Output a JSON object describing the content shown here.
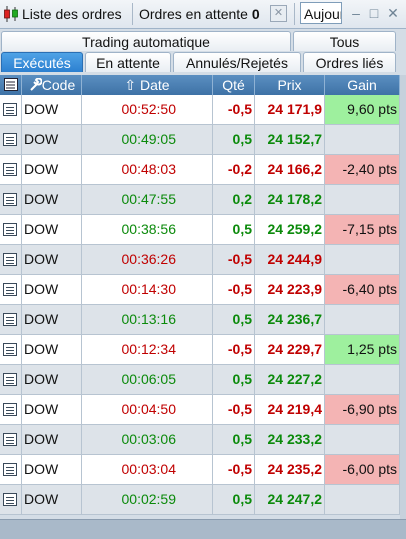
{
  "topbar": {
    "title": "Liste des ordres",
    "pending_label": "Ordres en attente",
    "pending_count": "0",
    "input_value": "Aujourd'hui",
    "close_label": "✕",
    "minimize": "–",
    "maximize": "□",
    "close_window": "✕"
  },
  "tabs_row1": [
    "Trading automatique",
    "Tous"
  ],
  "tabs_row2": [
    "Exécutés",
    "En attente",
    "Annulés/Rejetés",
    "Ordres liés"
  ],
  "columns": {
    "code": "Code",
    "date": "Date",
    "qty": "Qté",
    "prix": "Prix",
    "gain": "Gain"
  },
  "colors": {
    "up": "#0b8a0b",
    "down": "#c00000",
    "gain_pos": "#9ef09e",
    "gain_neg": "#f4b4b4"
  },
  "rows": [
    {
      "code": "DOW",
      "date": "00:52:50",
      "qty": "-0,5",
      "prix": "24 171,9",
      "gain": "9,60 pts",
      "dir": "down",
      "gain_sign": "pos"
    },
    {
      "code": "DOW",
      "date": "00:49:05",
      "qty": "0,5",
      "prix": "24 152,7",
      "gain": "",
      "dir": "up",
      "gain_sign": ""
    },
    {
      "code": "DOW",
      "date": "00:48:03",
      "qty": "-0,2",
      "prix": "24 166,2",
      "gain": "-2,40 pts",
      "dir": "down",
      "gain_sign": "neg"
    },
    {
      "code": "DOW",
      "date": "00:47:55",
      "qty": "0,2",
      "prix": "24 178,2",
      "gain": "",
      "dir": "up",
      "gain_sign": ""
    },
    {
      "code": "DOW",
      "date": "00:38:56",
      "qty": "0,5",
      "prix": "24 259,2",
      "gain": "-7,15 pts",
      "dir": "up",
      "gain_sign": "neg"
    },
    {
      "code": "DOW",
      "date": "00:36:26",
      "qty": "-0,5",
      "prix": "24 244,9",
      "gain": "",
      "dir": "down",
      "gain_sign": ""
    },
    {
      "code": "DOW",
      "date": "00:14:30",
      "qty": "-0,5",
      "prix": "24 223,9",
      "gain": "-6,40 pts",
      "dir": "down",
      "gain_sign": "neg"
    },
    {
      "code": "DOW",
      "date": "00:13:16",
      "qty": "0,5",
      "prix": "24 236,7",
      "gain": "",
      "dir": "up",
      "gain_sign": ""
    },
    {
      "code": "DOW",
      "date": "00:12:34",
      "qty": "-0,5",
      "prix": "24 229,7",
      "gain": "1,25 pts",
      "dir": "down",
      "gain_sign": "pos"
    },
    {
      "code": "DOW",
      "date": "00:06:05",
      "qty": "0,5",
      "prix": "24 227,2",
      "gain": "",
      "dir": "up",
      "gain_sign": ""
    },
    {
      "code": "DOW",
      "date": "00:04:50",
      "qty": "-0,5",
      "prix": "24 219,4",
      "gain": "-6,90 pts",
      "dir": "down",
      "gain_sign": "neg"
    },
    {
      "code": "DOW",
      "date": "00:03:06",
      "qty": "0,5",
      "prix": "24 233,2",
      "gain": "",
      "dir": "up",
      "gain_sign": ""
    },
    {
      "code": "DOW",
      "date": "00:03:04",
      "qty": "-0,5",
      "prix": "24 235,2",
      "gain": "-6,00 pts",
      "dir": "down",
      "gain_sign": "neg"
    },
    {
      "code": "DOW",
      "date": "00:02:59",
      "qty": "0,5",
      "prix": "24 247,2",
      "gain": "",
      "dir": "up",
      "gain_sign": ""
    }
  ]
}
